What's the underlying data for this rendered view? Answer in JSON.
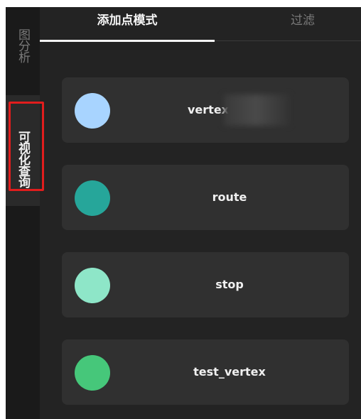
{
  "sidebar": {
    "items": [
      {
        "label": "图分析"
      },
      {
        "label": "可视化查询"
      }
    ]
  },
  "tabs": [
    {
      "label": "添加点模式",
      "active": true
    },
    {
      "label": "过滤",
      "active": false
    }
  ],
  "vertices": [
    {
      "name": "vertex",
      "color": "#a8d4ff"
    },
    {
      "name": "route",
      "color": "#26a69a"
    },
    {
      "name": "stop",
      "color": "#8ee6c8"
    },
    {
      "name": "test_vertex",
      "color": "#46c77a"
    }
  ],
  "colors": {
    "highlight": "#e11d1d"
  }
}
